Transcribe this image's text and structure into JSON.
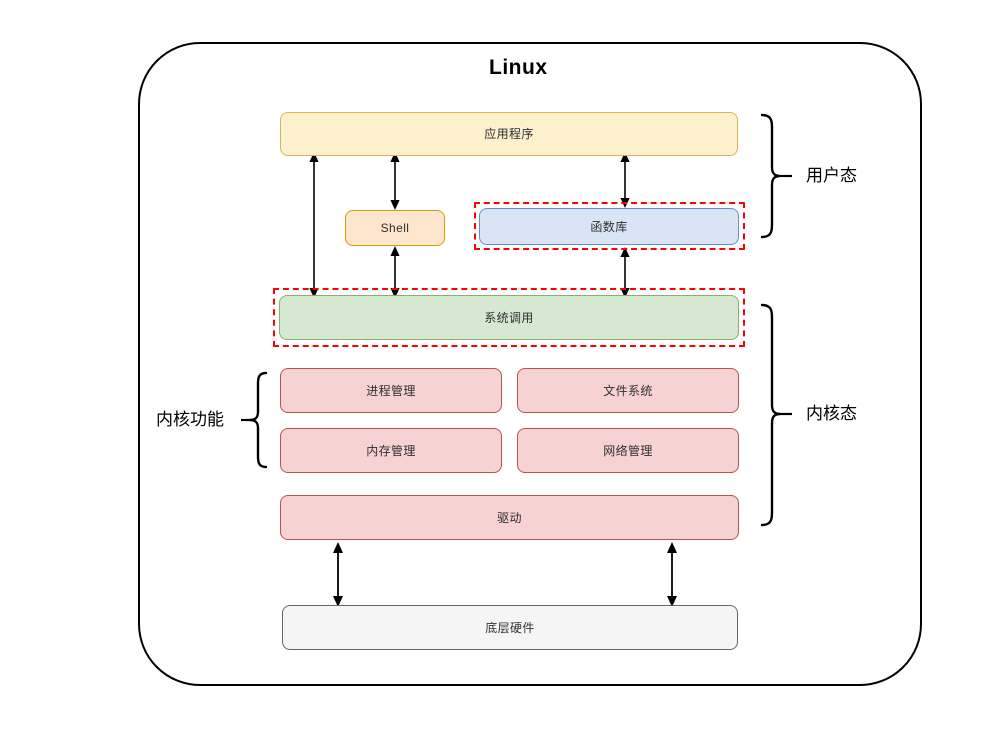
{
  "diagram": {
    "title": "Linux",
    "outer_frame_name": "linux-system-boundary"
  },
  "layers": {
    "application": {
      "label": "应用程序",
      "fill": "#fdf0cd",
      "stroke": "#d6b656"
    },
    "shell": {
      "label": "Shell",
      "fill": "#fde5ce",
      "stroke": "#d79b00"
    },
    "library": {
      "label": "函数库",
      "fill": "#d9e5f7",
      "stroke": "#6c8ebf"
    },
    "syscall": {
      "label": "系统调用",
      "fill": "#d6e8d1",
      "stroke": "#82b366"
    },
    "driver": {
      "label": "驱动",
      "fill": "#f6d3d2",
      "stroke": "#b85450"
    },
    "hardware": {
      "label": "底层硬件",
      "fill": "#f5f5f5",
      "stroke": "#666666"
    }
  },
  "kernel_modules": [
    {
      "label": "进程管理"
    },
    {
      "label": "文件系统"
    },
    {
      "label": "内存管理"
    },
    {
      "label": "网络管理"
    }
  ],
  "annotations": {
    "user_mode": "用户态",
    "kernel_mode": "内核态",
    "kernel_functions": "内核功能",
    "highlight_color": "#ff0000"
  }
}
